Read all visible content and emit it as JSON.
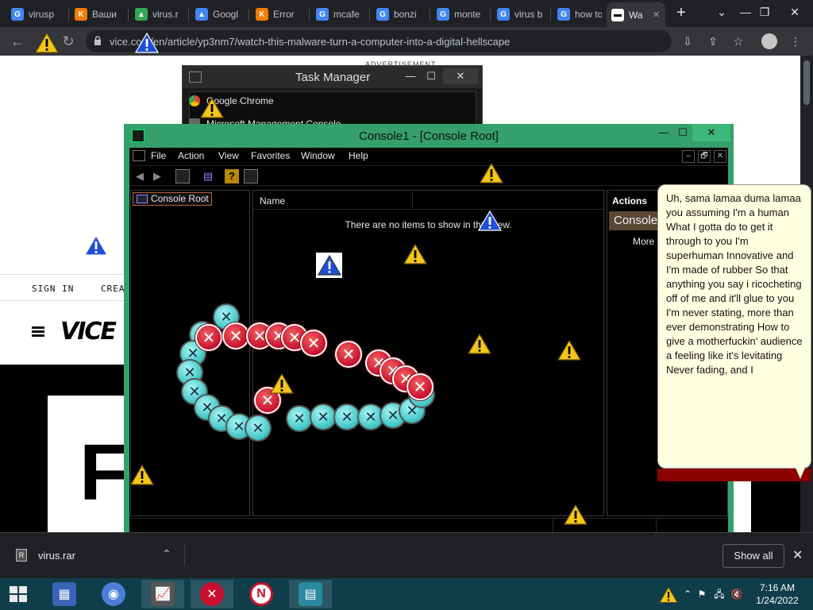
{
  "browser": {
    "tabs": [
      {
        "title": "virusp",
        "icon": "google-icon",
        "color": "#4285f4",
        "glyph": "G"
      },
      {
        "title": "Ваши",
        "icon": "vk-icon",
        "color": "#f57c00",
        "glyph": "K"
      },
      {
        "title": "virus.r",
        "icon": "drive-icon",
        "color": "#34a853",
        "glyph": "▲"
      },
      {
        "title": "Googl",
        "icon": "drive-icon",
        "color": "#4285f4",
        "glyph": "▲"
      },
      {
        "title": "Error",
        "icon": "vk-icon",
        "color": "#f57c00",
        "glyph": "K"
      },
      {
        "title": "mcafe",
        "icon": "google-icon",
        "color": "#4285f4",
        "glyph": "G"
      },
      {
        "title": "bonzi",
        "icon": "google-icon",
        "color": "#4285f4",
        "glyph": "G"
      },
      {
        "title": "monte",
        "icon": "google-icon",
        "color": "#4285f4",
        "glyph": "G"
      },
      {
        "title": "virus b",
        "icon": "google-icon",
        "color": "#4285f4",
        "glyph": "G"
      },
      {
        "title": "how to",
        "icon": "google-icon",
        "color": "#4285f4",
        "glyph": "G"
      },
      {
        "title": "Wa",
        "icon": "vice-icon",
        "color": "#ffffff",
        "glyph": "▬"
      }
    ],
    "new_tab": "+",
    "window_controls": {
      "minimize": "⌄",
      "restore": "—",
      "maximize": "❐",
      "close": "✕"
    },
    "url": "vice.com/en/article/yp3nm7/watch-this-malware-turn-a-computer-into-a-digital-hellscape",
    "nav": {
      "back": "←",
      "reload": "↻"
    },
    "toolbar_icons": {
      "install": "⇩",
      "share": "⇪",
      "bookmark": "☆",
      "menu": "⋮"
    }
  },
  "webpage": {
    "advertisement": "ADVERTISEMENT",
    "nav_links": [
      "SIGN IN",
      "CREATE A"
    ],
    "logo": "VICE",
    "headline_letter": "F"
  },
  "task_manager": {
    "title": "Task Manager",
    "minimize": "—",
    "maximize": "☐",
    "close": "✕",
    "processes": [
      "Google Chrome",
      "Microsoft Management Console"
    ]
  },
  "mmc": {
    "title": "Console1 - [Console Root]",
    "minimize": "—",
    "maximize": "☐",
    "close": "✕",
    "menu": [
      "File",
      "Action",
      "View",
      "Favorites",
      "Window",
      "Help"
    ],
    "mdi_controls": [
      "–",
      "🗗",
      "✕"
    ],
    "tree_root": "Console Root",
    "list_header": "Name",
    "empty_message": "There are no items to show in this view.",
    "actions_header": "Actions",
    "actions_selected": "Console",
    "actions_more": "More"
  },
  "lyrics_bubble": {
    "text": "Uh, sama lamaa duma lamaa you assuming I'm a human What I gotta do to get it through to you I'm superhuman Innovative and I'm made of rubber So that anything you say i ricocheting off of me and it'll glue to you I'm never stating, more than ever demonstrating How to give a motherfuckin' audience a feeling like it's levitating Never fading, and I"
  },
  "downloads": {
    "file": "virus.rar",
    "file_icon_glyph": "R",
    "chevron": "⌃",
    "show_all": "Show all",
    "close": "✕"
  },
  "taskbar": {
    "time": "7:16 AM",
    "date": "1/24/2022",
    "tray_icons": {
      "flag": "⚑",
      "network": "🖧",
      "volume": "🔇"
    },
    "apps": [
      {
        "icon": "file-explorer-icon",
        "color": "#3a64b8",
        "glyph": "▦"
      },
      {
        "icon": "chrome-icon",
        "color": "#4c7dd8",
        "glyph": "◉"
      },
      {
        "icon": "task-manager-icon",
        "color": "#555555",
        "glyph": "📈"
      },
      {
        "icon": "error-app-icon",
        "color": "#c8102e",
        "glyph": "✕"
      },
      {
        "icon": "n-app-icon",
        "color": "#c8102e",
        "glyph": "N"
      },
      {
        "icon": "mmc-icon",
        "color": "#2a8aa0",
        "glyph": "▤"
      }
    ]
  },
  "colors": {
    "mmc_frame": "#35a06a",
    "chrome_dark": "#202124",
    "taskbar": "#0f3d4a",
    "bubble": "#ffffe1"
  }
}
